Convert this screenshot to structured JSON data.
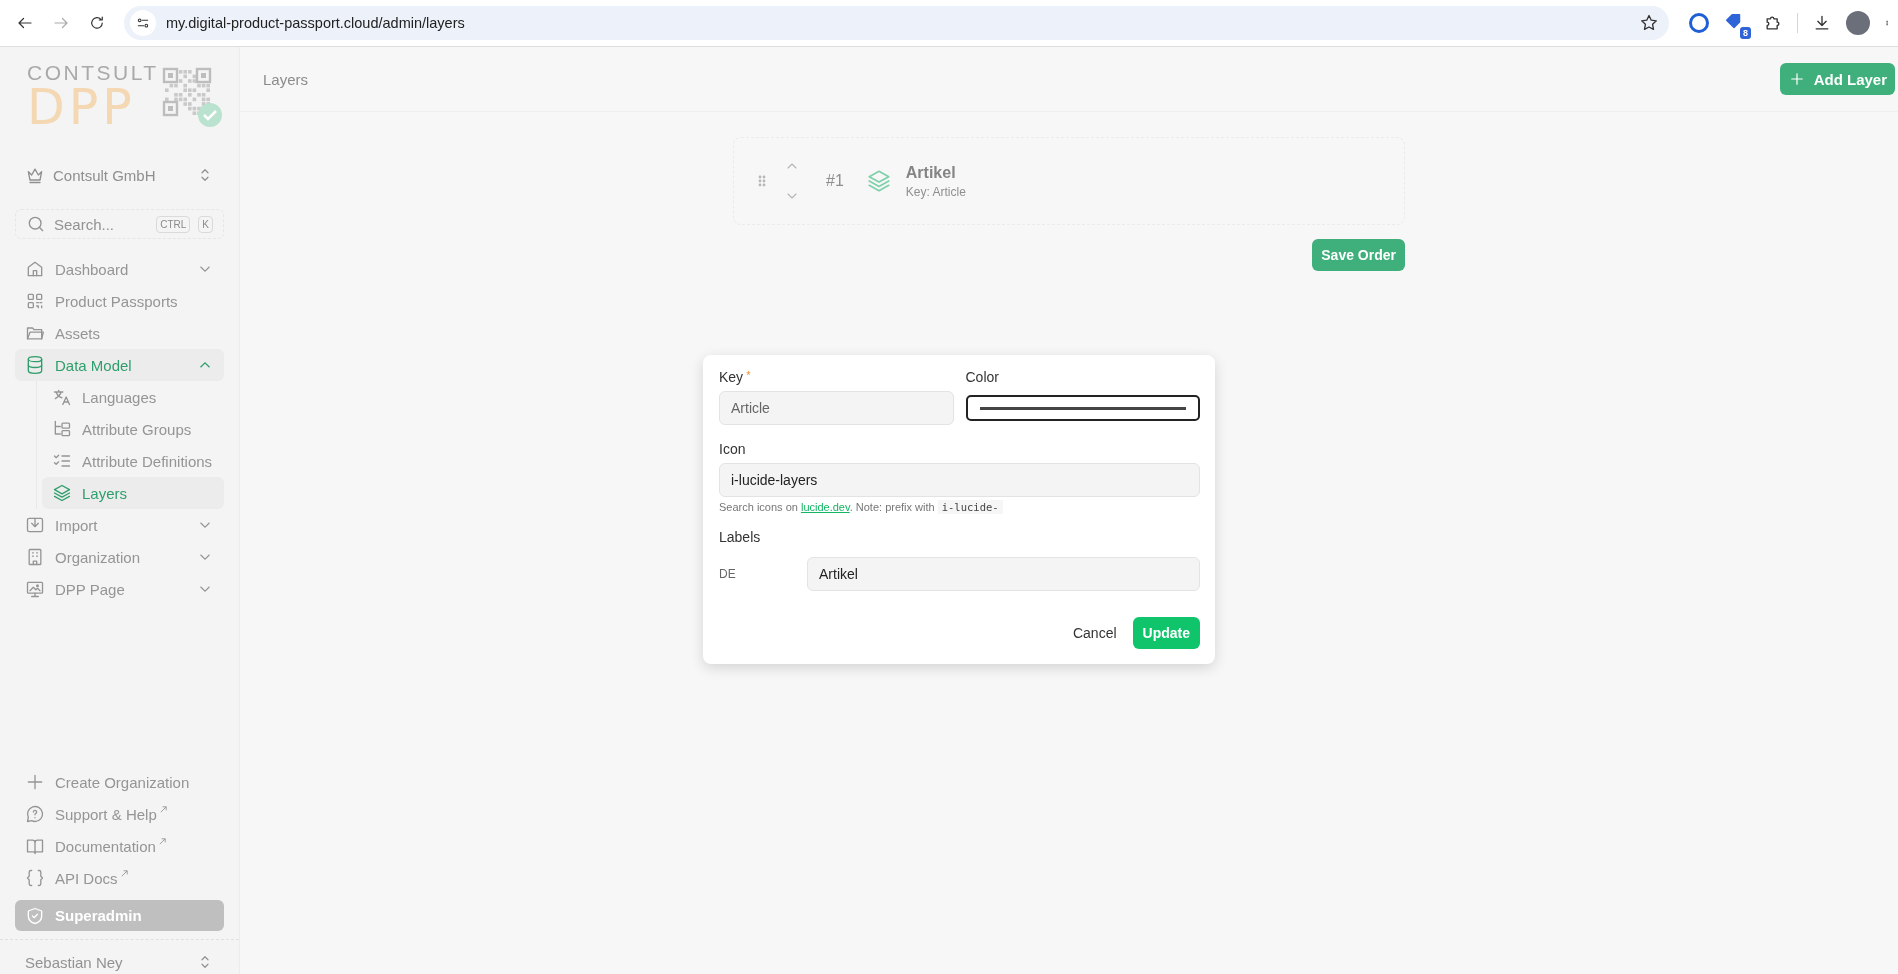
{
  "browser": {
    "url": "my.digital-product-passport.cloud/admin/layers",
    "extension_badge": "8"
  },
  "sidebar": {
    "logo": {
      "top": "CONTSULT",
      "bottom": "DPP"
    },
    "organization": "Contsult GmbH",
    "search": {
      "placeholder": "Search...",
      "keys": [
        "CTRL",
        "K"
      ]
    },
    "nav": [
      {
        "label": "Dashboard",
        "selected": false,
        "expanded": false
      },
      {
        "label": "Product Passports",
        "selected": false
      },
      {
        "label": "Assets",
        "selected": false
      },
      {
        "label": "Data Model",
        "selected": true,
        "expanded": true,
        "children": [
          {
            "label": "Languages",
            "selected": false
          },
          {
            "label": "Attribute Groups",
            "selected": false
          },
          {
            "label": "Attribute Definitions",
            "selected": false
          },
          {
            "label": "Layers",
            "selected": true
          }
        ]
      },
      {
        "label": "Import",
        "selected": false,
        "expanded": false
      },
      {
        "label": "Organization",
        "selected": false,
        "expanded": false
      },
      {
        "label": "DPP Page",
        "selected": false,
        "expanded": false
      }
    ],
    "footer_links": [
      {
        "label": "Create Organization",
        "external": false
      },
      {
        "label": "Support & Help",
        "external": true
      },
      {
        "label": "Documentation",
        "external": true
      },
      {
        "label": "API Docs",
        "external": true
      }
    ],
    "role_button": "Superadmin",
    "user": "Sebastian Ney"
  },
  "page": {
    "title": "Layers",
    "add_button": "Add Layer",
    "layers": [
      {
        "number": "#1",
        "name": "Artikel",
        "key": "Key: Article"
      }
    ],
    "save_button": "Save Order"
  },
  "dialog": {
    "key": {
      "label": "Key",
      "required_mark": "*",
      "value": "Article"
    },
    "color": {
      "label": "Color"
    },
    "icon": {
      "label": "Icon",
      "value": "i-lucide-layers",
      "help_before": "Search icons on",
      "help_link": "lucide.dev",
      "help_after": ". Note: prefix with",
      "help_code": "i-lucide-"
    },
    "labels": {
      "title": "Labels",
      "rows": [
        {
          "language": "DE",
          "value": "Artikel"
        }
      ]
    },
    "cancel_button": "Cancel",
    "update_button": "Update"
  }
}
